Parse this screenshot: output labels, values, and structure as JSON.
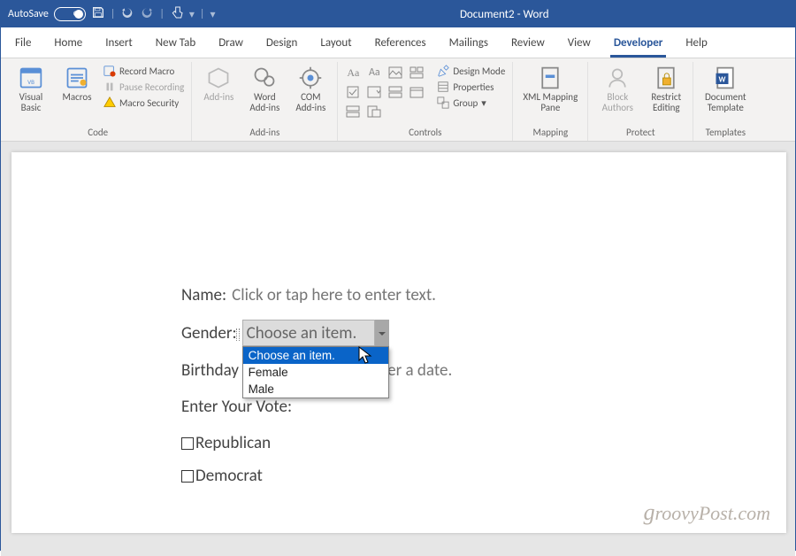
{
  "title_bar": {
    "autosave_label": "AutoSave",
    "autosave_state": "Off",
    "doc_title": "Document2 - Word"
  },
  "tabs": {
    "file": "File",
    "home": "Home",
    "insert": "Insert",
    "newtab": "New Tab",
    "draw": "Draw",
    "design": "Design",
    "layout": "Layout",
    "references": "References",
    "mailings": "Mailings",
    "review": "Review",
    "view": "View",
    "developer": "Developer",
    "help": "Help"
  },
  "ribbon": {
    "code": {
      "label": "Code",
      "visual_basic": "Visual Basic",
      "macros": "Macros",
      "record_macro": "Record Macro",
      "pause_recording": "Pause Recording",
      "macro_security": "Macro Security"
    },
    "addins": {
      "label": "Add-ins",
      "addins_btn": "Add-ins",
      "word_addins": "Word Add-ins",
      "com_addins": "COM Add-ins"
    },
    "controls": {
      "label": "Controls",
      "design_mode": "Design Mode",
      "properties": "Properties",
      "group": "Group"
    },
    "mapping": {
      "label": "Mapping",
      "xml_mapping": "XML Mapping Pane"
    },
    "protect": {
      "label": "Protect",
      "block_authors": "Block Authors",
      "restrict_editing": "Restrict Editing"
    },
    "templates": {
      "label": "Templates",
      "document_template": "Document Template"
    }
  },
  "form": {
    "name_label": "Name:",
    "name_placeholder": "Click or tap here to enter text.",
    "gender_label": "Gender:",
    "gender_selected": "Choose an item.",
    "gender_options": {
      "placeholder": "Choose an item.",
      "opt1": "Female",
      "opt2": "Male"
    },
    "birthday_label": "Birthday",
    "birthday_placeholder": "ter a date.",
    "vote_label": "Enter Your Vote:",
    "vote_opt1": "Republican",
    "vote_opt2": "Democrat"
  },
  "watermark": "groovyPost.com"
}
